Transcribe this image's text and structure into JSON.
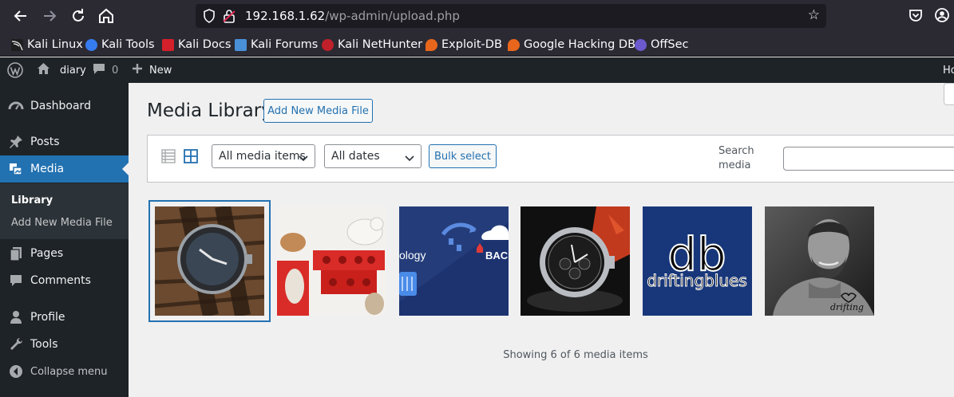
{
  "browser": {
    "url_host": "192.168.1.62",
    "url_path": "/wp-admin/upload.php",
    "bookmarks": [
      "Kali Linux",
      "Kali Tools",
      "Kali Docs",
      "Kali Forums",
      "Kali NetHunter",
      "Exploit-DB",
      "Google Hacking DB",
      "OffSec"
    ]
  },
  "admin_bar": {
    "site_name": "diary",
    "comments_count": "0",
    "new_label": "New",
    "right_text": "Ho"
  },
  "sidebar": {
    "items": [
      {
        "label": "Dashboard",
        "icon": "dashboard-icon"
      },
      {
        "label": "Posts",
        "icon": "pin-icon"
      },
      {
        "label": "Media",
        "icon": "media-icon"
      },
      {
        "label": "Pages",
        "icon": "pages-icon"
      },
      {
        "label": "Comments",
        "icon": "comment-icon"
      },
      {
        "label": "Profile",
        "icon": "user-icon"
      },
      {
        "label": "Tools",
        "icon": "wrench-icon"
      },
      {
        "label": "Collapse menu",
        "icon": "collapse-icon"
      }
    ],
    "submenu": {
      "library": "Library",
      "add_new": "Add New Media File"
    }
  },
  "main": {
    "title": "Media Library",
    "add_new_label": "Add New Media File",
    "filter_type": "All media items",
    "filter_date": "All dates",
    "bulk_select_label": "Bulk select",
    "search_label": "Search media",
    "items_count_text": "Showing 6 of 6 media items"
  },
  "attachments": [
    {
      "name": "watch-on-wood"
    },
    {
      "name": "cats-on-red-boxes"
    },
    {
      "name": "technology-backup-graphic",
      "text_left": "ology",
      "text_right": "BAC"
    },
    {
      "name": "chronograph-watch"
    },
    {
      "name": "driftingblues-logo",
      "text_top": "db",
      "text_bottom": "driftingblues"
    },
    {
      "name": "man-portrait",
      "text": "drifting"
    }
  ],
  "colors": {
    "accent": "#2271b1",
    "admin_dark": "#1d2327",
    "browser_dark": "#2b2a33"
  }
}
